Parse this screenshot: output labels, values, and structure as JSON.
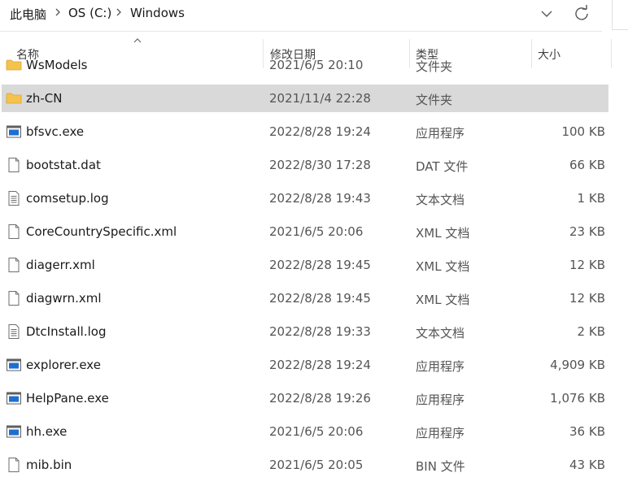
{
  "address": {
    "crumbs": [
      "此电脑",
      "OS (C:)",
      "Windows"
    ],
    "icons": [
      "chevron-right-icon",
      "chevron-down-icon",
      "refresh-icon"
    ]
  },
  "header": {
    "name": "名称",
    "date": "修改日期",
    "type": "类型",
    "size": "大小",
    "sort": "ascending"
  },
  "files": [
    {
      "name": "WsModels",
      "date": "2021/6/5 20:10",
      "type": "文件夹",
      "size": "",
      "icon": "folder-icon",
      "partial": true
    },
    {
      "name": "zh-CN",
      "date": "2021/11/4 22:28",
      "type": "文件夹",
      "size": "",
      "icon": "folder-icon",
      "selected": true
    },
    {
      "name": "bfsvc.exe",
      "date": "2022/8/28 19:24",
      "type": "应用程序",
      "size": "100 KB",
      "icon": "exe-icon"
    },
    {
      "name": "bootstat.dat",
      "date": "2022/8/30 17:28",
      "type": "DAT 文件",
      "size": "66 KB",
      "icon": "file-icon"
    },
    {
      "name": "comsetup.log",
      "date": "2022/8/28 19:43",
      "type": "文本文档",
      "size": "1 KB",
      "icon": "text-file-icon"
    },
    {
      "name": "CoreCountrySpecific.xml",
      "date": "2021/6/5 20:06",
      "type": "XML 文档",
      "size": "23 KB",
      "icon": "file-icon"
    },
    {
      "name": "diagerr.xml",
      "date": "2022/8/28 19:45",
      "type": "XML 文档",
      "size": "12 KB",
      "icon": "file-icon"
    },
    {
      "name": "diagwrn.xml",
      "date": "2022/8/28 19:45",
      "type": "XML 文档",
      "size": "12 KB",
      "icon": "file-icon"
    },
    {
      "name": "DtcInstall.log",
      "date": "2022/8/28 19:33",
      "type": "文本文档",
      "size": "2 KB",
      "icon": "text-file-icon"
    },
    {
      "name": "explorer.exe",
      "date": "2022/8/28 19:24",
      "type": "应用程序",
      "size": "4,909 KB",
      "icon": "exe-icon"
    },
    {
      "name": "HelpPane.exe",
      "date": "2022/8/28 19:26",
      "type": "应用程序",
      "size": "1,076 KB",
      "icon": "exe-icon"
    },
    {
      "name": "hh.exe",
      "date": "2021/6/5 20:06",
      "type": "应用程序",
      "size": "36 KB",
      "icon": "exe-icon"
    },
    {
      "name": "mib.bin",
      "date": "2021/6/5 20:05",
      "type": "BIN 文件",
      "size": "43 KB",
      "icon": "file-icon"
    }
  ],
  "colors": {
    "selected": "#d9d9d9",
    "folder": "#f4c24d",
    "exe": "#1e6fd0"
  }
}
